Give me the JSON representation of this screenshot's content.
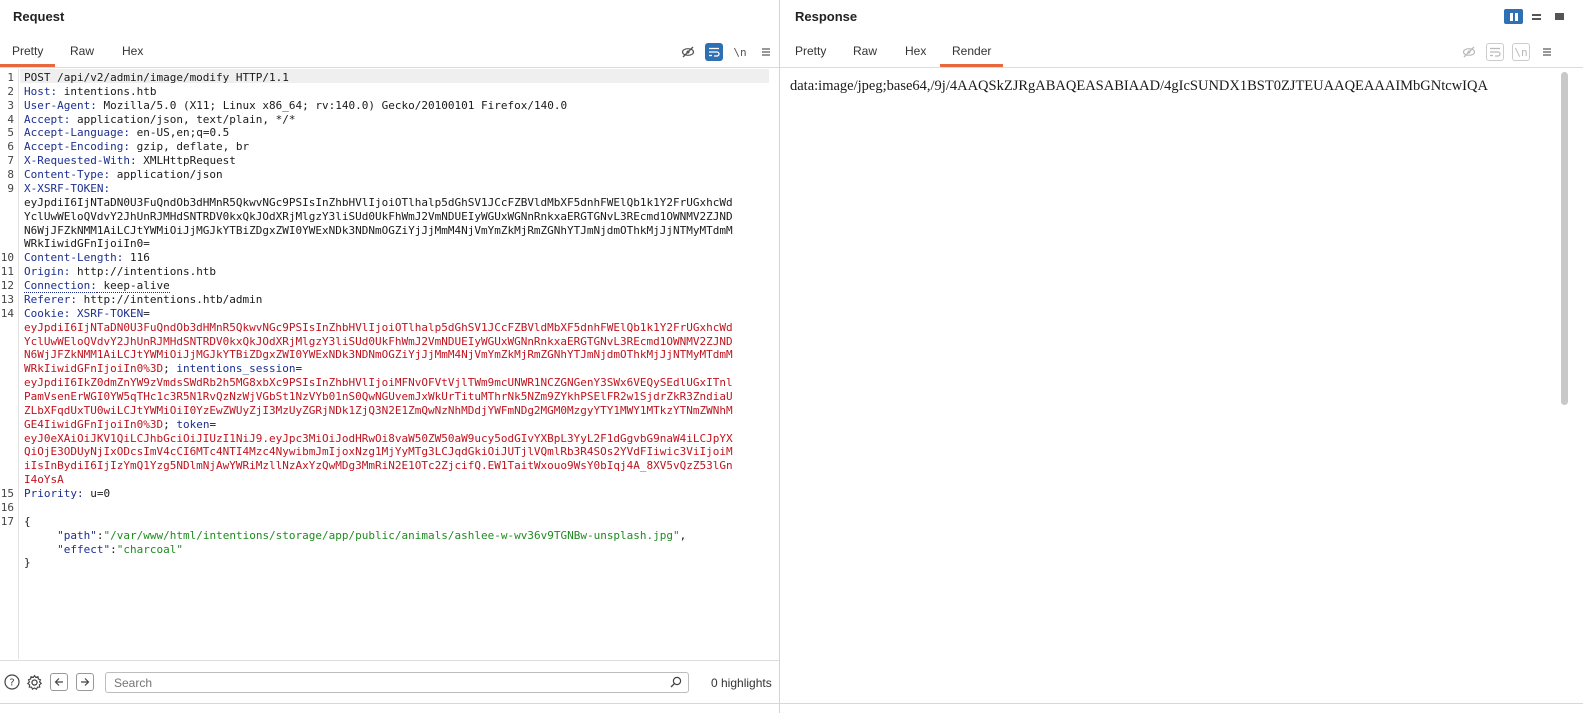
{
  "request": {
    "title": "Request",
    "tabs": [
      "Pretty",
      "Raw",
      "Hex"
    ],
    "active_tab": "Pretty",
    "tool_icons": [
      "eye-slash-icon",
      "wrap-lines-icon",
      "newline-icon",
      "menu-icon"
    ],
    "line_numbers": [
      "1",
      "2",
      "3",
      "4",
      "5",
      "6",
      "7",
      "8",
      "9",
      "10",
      "11",
      "12",
      "13",
      "14",
      "15",
      "16",
      "17"
    ],
    "lines": {
      "l1": "POST /api/v2/admin/image/modify HTTP/1.1",
      "l2_key": "Host:",
      "l2_val": " intentions.htb",
      "l3_key": "User-Agent:",
      "l3_val": " Mozilla/5.0 (X11; Linux x86_64; rv:140.0) Gecko/20100101 Firefox/140.0",
      "l4_key": "Accept:",
      "l4_val": " application/json, text/plain, */*",
      "l5_key": "Accept-Language:",
      "l5_val": " en-US,en;q=0.5",
      "l6_key": "Accept-Encoding:",
      "l6_val": " gzip, deflate, br",
      "l7_key": "X-Requested-With:",
      "l7_val": " XMLHttpRequest",
      "l8_key": "Content-Type:",
      "l8_val": " application/json",
      "l9_key": "X-XSRF-TOKEN:",
      "l9_v1": "eyJpdiI6IjNTaDN0U3FuQndOb3dHMnR5QkwvNGc9PSIsInZhbHVlIjoiOTlhalp5dGhSV1JCcFZBVldMbXF5dnhFWElQb1k1Y2FrUGxhcWd",
      "l9_v2": "YclUwWEloQVdvY2JhUnRJMHdSNTRDV0kxQkJOdXRjMlgzY3liSUd0UkFhWmJ2VmNDUEIyWGUxWGNnRnkxaERGTGNvL3REcmd1OWNMV2ZJND",
      "l9_v3": "N6WjJFZkNMM1AiLCJtYWMiOiJjMGJkYTBiZDgxZWI0YWExNDk3NDNmOGZiYjJjMmM4NjVmYmZkMjRmZGNhYTJmNjdmOThkMjJjNTMyMTdmM",
      "l9_v4": "WRkIiwidGFnIjoiIn0=",
      "l10_key": "Content-Length:",
      "l10_val": " 116",
      "l11_key": "Origin:",
      "l11_val": " http://intentions.htb",
      "l12_key": "Connection:",
      "l12_val": " keep-alive",
      "l13_key": "Referer:",
      "l13_val": " http://intentions.htb/admin",
      "l14_key": "Cookie:",
      "l14_ck1": "XSRF-TOKEN",
      "l14_v1": "eyJpdiI6IjNTaDN0U3FuQndOb3dHMnR5QkwvNGc9PSIsInZhbHVlIjoiOTlhalp5dGhSV1JCcFZBVldMbXF5dnhFWElQb1k1Y2FrUGxhcWd",
      "l14_v2": "YclUwWEloQVdvY2JhUnRJMHdSNTRDV0kxQkJOdXRjMlgzY3liSUd0UkFhWmJ2VmNDUEIyWGUxWGNnRnkxaERGTGNvL3REcmd1OWNMV2ZJND",
      "l14_v3": "N6WjJFZkNMM1AiLCJtYWMiOiJjMGJkYTBiZDgxZWI0YWExNDk3NDNmOGZiYjJjMmM4NjVmYmZkMjRmZGNhYTJmNjdmOThkMjJjNTMyMTdmM",
      "l14_v4": "WRkIiwidGFnIjoiIn0%3D",
      "l14_ck2": "intentions_session",
      "l14_v5": "eyJpdiI6IkZ0dmZnYW9zVmdsSWdRb2h5MG8xbXc9PSIsInZhbHVlIjoiMFNvOFVtVjlTWm9mcUNWR1NCZGNGenY3SWx6VEQySEdlUGxITnl",
      "l14_v6": "PamVsenErWGI0YW5qTHc1c3R5N1RvQzNzWjVGbSt1NzVYb01nS0QwNGUvemJxWkUrTituMThrNk5NZm9ZYkhPSElFR2w1SjdrZkR3ZndiaU",
      "l14_v7": "ZLbXFqdUxTU0wiLCJtYWMiOiI0YzEwZWUyZjI3MzUyZGRjNDk1ZjQ3N2E1ZmQwNzNhMDdjYWFmNDg2MGM0MzgyYTY1MWY1MTkzYTNmZWNhM",
      "l14_v8": "GE4IiwidGFnIjoiIn0%3D",
      "l14_ck3": "token",
      "l14_v9": "eyJ0eXAiOiJKV1QiLCJhbGciOiJIUzI1NiJ9.eyJpc3MiOiJodHRwOi8vaW50ZW50aW9ucy5odGIvYXBpL3YyL2F1dGgvbG9naW4iLCJpYX",
      "l14_v10": "QiOjE3ODUyNjIxODcsImV4cCI6MTc4NTI4Mzc4NywibmJmIjoxNzg1MjYyMTg3LCJqdGkiOiJUTjlVQmlRb3R4SOs2YVdFIiwic3ViIjoiM",
      "l14_v11": "iIsInBydiI6IjIzYmQ1Yzg5NDlmNjAwYWRiMzllNzAxYzQwMDg3MmRiN2E1OTc2ZjcifQ.EW1TaitWxouo9WsY0bIqj4A_8XV5vQzZ53lGn",
      "l14_v12": "I4oYsA",
      "l15_key": "Priority:",
      "l15_val": " u=0",
      "l17_open": "{",
      "l17_path_key": "\"path\"",
      "l17_path_val": "\"/var/www/html/intentions/storage/app/public/animals/ashlee-w-wv36v9TGNBw-unsplash.jpg\"",
      "l17_effect_key": "\"effect\"",
      "l17_effect_val": "\"charcoal\"",
      "l17_close": "}"
    },
    "search_placeholder": "Search",
    "highlights": "0 highlights"
  },
  "response": {
    "title": "Response",
    "tabs": [
      "Pretty",
      "Raw",
      "Hex",
      "Render"
    ],
    "active_tab": "Render",
    "render_text": "data:image/jpeg;base64,/9j/4AAQSkZJRgABAQEASABIAAD/4gIcSUNDX1BST0ZJTEUAAQEAAAIMbGNtcwIQA",
    "layout_icons": [
      "split-vertical-icon",
      "split-horizontal-icon",
      "tabs-layout-icon"
    ]
  },
  "colors": {
    "accent_tab": "#e8673c",
    "active_icon": "#2f6fb4",
    "header_key": "#1c2f8f",
    "cookie_value": "#c0141f",
    "json_string": "#1f8b1f"
  }
}
